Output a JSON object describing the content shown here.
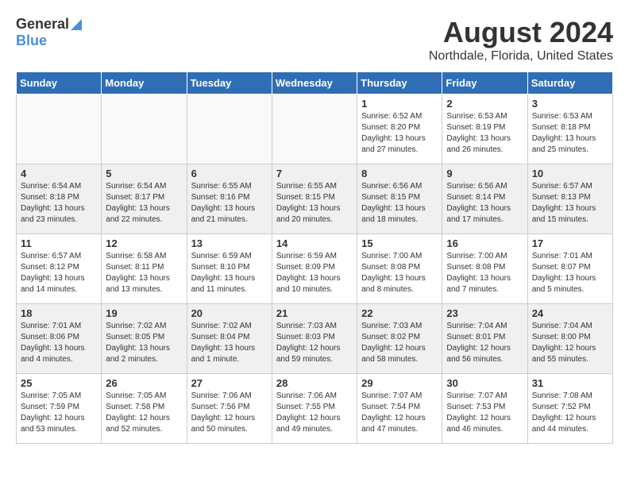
{
  "logo": {
    "general": "General",
    "blue": "Blue"
  },
  "header": {
    "month_year": "August 2024",
    "location": "Northdale, Florida, United States"
  },
  "weekdays": [
    "Sunday",
    "Monday",
    "Tuesday",
    "Wednesday",
    "Thursday",
    "Friday",
    "Saturday"
  ],
  "weeks": [
    [
      {
        "day": "",
        "info": "",
        "empty": true
      },
      {
        "day": "",
        "info": "",
        "empty": true
      },
      {
        "day": "",
        "info": "",
        "empty": true
      },
      {
        "day": "",
        "info": "",
        "empty": true
      },
      {
        "day": "1",
        "info": "Sunrise: 6:52 AM\nSunset: 8:20 PM\nDaylight: 13 hours\nand 27 minutes.",
        "empty": false
      },
      {
        "day": "2",
        "info": "Sunrise: 6:53 AM\nSunset: 8:19 PM\nDaylight: 13 hours\nand 26 minutes.",
        "empty": false
      },
      {
        "day": "3",
        "info": "Sunrise: 6:53 AM\nSunset: 8:18 PM\nDaylight: 13 hours\nand 25 minutes.",
        "empty": false
      }
    ],
    [
      {
        "day": "4",
        "info": "Sunrise: 6:54 AM\nSunset: 8:18 PM\nDaylight: 13 hours\nand 23 minutes.",
        "empty": false
      },
      {
        "day": "5",
        "info": "Sunrise: 6:54 AM\nSunset: 8:17 PM\nDaylight: 13 hours\nand 22 minutes.",
        "empty": false
      },
      {
        "day": "6",
        "info": "Sunrise: 6:55 AM\nSunset: 8:16 PM\nDaylight: 13 hours\nand 21 minutes.",
        "empty": false
      },
      {
        "day": "7",
        "info": "Sunrise: 6:55 AM\nSunset: 8:15 PM\nDaylight: 13 hours\nand 20 minutes.",
        "empty": false
      },
      {
        "day": "8",
        "info": "Sunrise: 6:56 AM\nSunset: 8:15 PM\nDaylight: 13 hours\nand 18 minutes.",
        "empty": false
      },
      {
        "day": "9",
        "info": "Sunrise: 6:56 AM\nSunset: 8:14 PM\nDaylight: 13 hours\nand 17 minutes.",
        "empty": false
      },
      {
        "day": "10",
        "info": "Sunrise: 6:57 AM\nSunset: 8:13 PM\nDaylight: 13 hours\nand 15 minutes.",
        "empty": false
      }
    ],
    [
      {
        "day": "11",
        "info": "Sunrise: 6:57 AM\nSunset: 8:12 PM\nDaylight: 13 hours\nand 14 minutes.",
        "empty": false
      },
      {
        "day": "12",
        "info": "Sunrise: 6:58 AM\nSunset: 8:11 PM\nDaylight: 13 hours\nand 13 minutes.",
        "empty": false
      },
      {
        "day": "13",
        "info": "Sunrise: 6:59 AM\nSunset: 8:10 PM\nDaylight: 13 hours\nand 11 minutes.",
        "empty": false
      },
      {
        "day": "14",
        "info": "Sunrise: 6:59 AM\nSunset: 8:09 PM\nDaylight: 13 hours\nand 10 minutes.",
        "empty": false
      },
      {
        "day": "15",
        "info": "Sunrise: 7:00 AM\nSunset: 8:08 PM\nDaylight: 13 hours\nand 8 minutes.",
        "empty": false
      },
      {
        "day": "16",
        "info": "Sunrise: 7:00 AM\nSunset: 8:08 PM\nDaylight: 13 hours\nand 7 minutes.",
        "empty": false
      },
      {
        "day": "17",
        "info": "Sunrise: 7:01 AM\nSunset: 8:07 PM\nDaylight: 13 hours\nand 5 minutes.",
        "empty": false
      }
    ],
    [
      {
        "day": "18",
        "info": "Sunrise: 7:01 AM\nSunset: 8:06 PM\nDaylight: 13 hours\nand 4 minutes.",
        "empty": false
      },
      {
        "day": "19",
        "info": "Sunrise: 7:02 AM\nSunset: 8:05 PM\nDaylight: 13 hours\nand 2 minutes.",
        "empty": false
      },
      {
        "day": "20",
        "info": "Sunrise: 7:02 AM\nSunset: 8:04 PM\nDaylight: 13 hours\nand 1 minute.",
        "empty": false
      },
      {
        "day": "21",
        "info": "Sunrise: 7:03 AM\nSunset: 8:03 PM\nDaylight: 12 hours\nand 59 minutes.",
        "empty": false
      },
      {
        "day": "22",
        "info": "Sunrise: 7:03 AM\nSunset: 8:02 PM\nDaylight: 12 hours\nand 58 minutes.",
        "empty": false
      },
      {
        "day": "23",
        "info": "Sunrise: 7:04 AM\nSunset: 8:01 PM\nDaylight: 12 hours\nand 56 minutes.",
        "empty": false
      },
      {
        "day": "24",
        "info": "Sunrise: 7:04 AM\nSunset: 8:00 PM\nDaylight: 12 hours\nand 55 minutes.",
        "empty": false
      }
    ],
    [
      {
        "day": "25",
        "info": "Sunrise: 7:05 AM\nSunset: 7:59 PM\nDaylight: 12 hours\nand 53 minutes.",
        "empty": false
      },
      {
        "day": "26",
        "info": "Sunrise: 7:05 AM\nSunset: 7:58 PM\nDaylight: 12 hours\nand 52 minutes.",
        "empty": false
      },
      {
        "day": "27",
        "info": "Sunrise: 7:06 AM\nSunset: 7:56 PM\nDaylight: 12 hours\nand 50 minutes.",
        "empty": false
      },
      {
        "day": "28",
        "info": "Sunrise: 7:06 AM\nSunset: 7:55 PM\nDaylight: 12 hours\nand 49 minutes.",
        "empty": false
      },
      {
        "day": "29",
        "info": "Sunrise: 7:07 AM\nSunset: 7:54 PM\nDaylight: 12 hours\nand 47 minutes.",
        "empty": false
      },
      {
        "day": "30",
        "info": "Sunrise: 7:07 AM\nSunset: 7:53 PM\nDaylight: 12 hours\nand 46 minutes.",
        "empty": false
      },
      {
        "day": "31",
        "info": "Sunrise: 7:08 AM\nSunset: 7:52 PM\nDaylight: 12 hours\nand 44 minutes.",
        "empty": false
      }
    ]
  ]
}
